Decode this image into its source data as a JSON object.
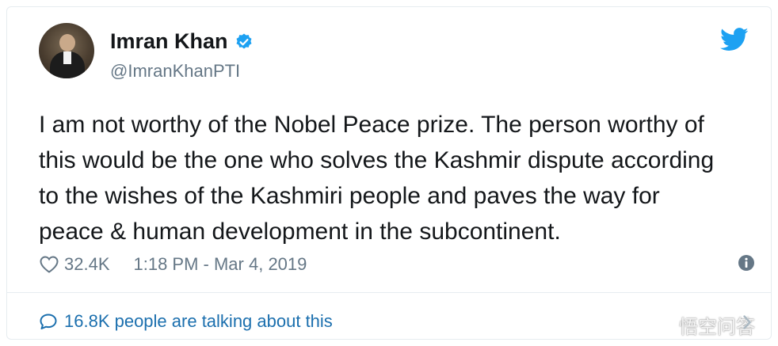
{
  "user": {
    "name": "Imran Khan",
    "handle": "@ImranKhanPTI",
    "verified_icon": "verified-badge-icon",
    "avatar": "avatar-photo"
  },
  "tweet": {
    "text": "I am not worthy of the Nobel Peace prize. The person worthy of\nthis would be the one who solves the Kashmir dispute according\nto the wishes of the Kashmiri people and paves the way for\npeace & human development in the subcontinent."
  },
  "meta": {
    "likes": "32.4K",
    "timestamp": "1:18 PM - Mar 4, 2019"
  },
  "footer": {
    "talking": "16.8K people are talking about this"
  },
  "watermark": {
    "text": "悟空问答"
  },
  "colors": {
    "twitter_blue": "#1da1f2",
    "link_blue": "#1b6fae",
    "muted_gray": "#657786",
    "text_dark": "#14171a",
    "border": "#e6ecf0"
  }
}
